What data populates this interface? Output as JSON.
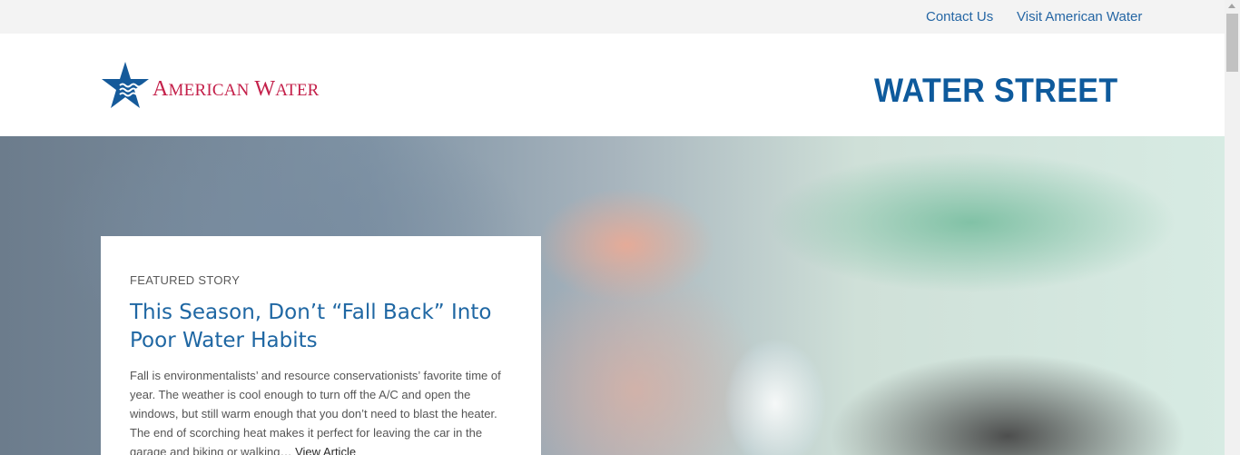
{
  "topbar": {
    "contact_label": "Contact Us",
    "visit_label": "Visit American Water"
  },
  "header": {
    "logo_text_first": "A",
    "logo_text_first_rest": "MERICAN",
    "logo_text_second": "W",
    "logo_text_second_rest": "ATER",
    "brand_title": "WATER STREET"
  },
  "featured": {
    "kicker": "FEATURED STORY",
    "title": "This Season, Don’t “Fall Back” Into Poor Water Habits",
    "excerpt": "Fall is environmentalists’ and resource conservationists’ favorite time of year. The weather is cool enough to turn off the A/C and open the windows, but still warm enough that you don’t need to blast the heater. The end of scorching heat makes it perfect for leaving the car in the garage and biking or walking… ",
    "link_label": "View Article"
  },
  "colors": {
    "accent_blue": "#1f67a3",
    "brand_blue": "#0e5a9c",
    "logo_red": "#c4204a",
    "topbar_bg": "#f3f3f3"
  },
  "icons": {
    "logo": "star-water-logo-icon"
  }
}
